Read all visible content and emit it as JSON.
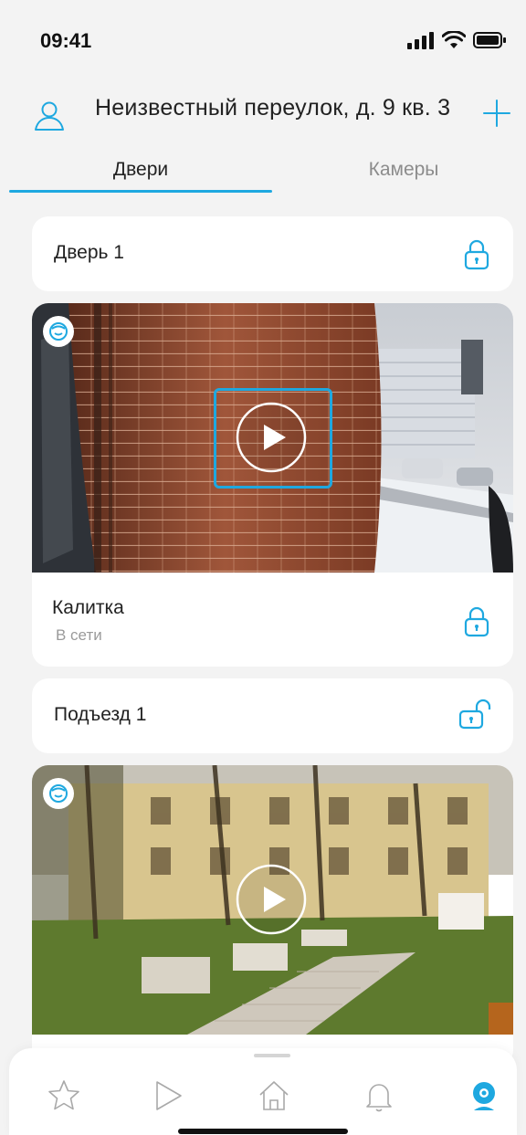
{
  "status_bar": {
    "time": "09:41"
  },
  "header": {
    "address": "Неизвестный переулок, д. 9 кв. 3"
  },
  "tabs": [
    {
      "label": "Двери",
      "active": true
    },
    {
      "label": "Камеры",
      "active": false
    }
  ],
  "doors": [
    {
      "title": "Дверь 1",
      "lock_state": "locked"
    },
    {
      "title": "Калитка",
      "status": "В сети",
      "lock_state": "locked"
    },
    {
      "title": "Подъезд 1",
      "lock_state": "unlocked"
    }
  ],
  "icons": {
    "avatar": "user-icon",
    "add": "plus-icon",
    "lock": "lock-icon",
    "unlock": "unlock-icon",
    "face": "face-recognition-icon",
    "play": "play-icon"
  },
  "bottom_nav": {
    "items": [
      "star-icon",
      "play-icon",
      "home-icon",
      "bell-icon",
      "camera-icon"
    ],
    "active": "camera-icon"
  },
  "colors": {
    "accent": "#1EA8E0",
    "background": "#F3F3F3",
    "card": "#FFFFFF"
  }
}
